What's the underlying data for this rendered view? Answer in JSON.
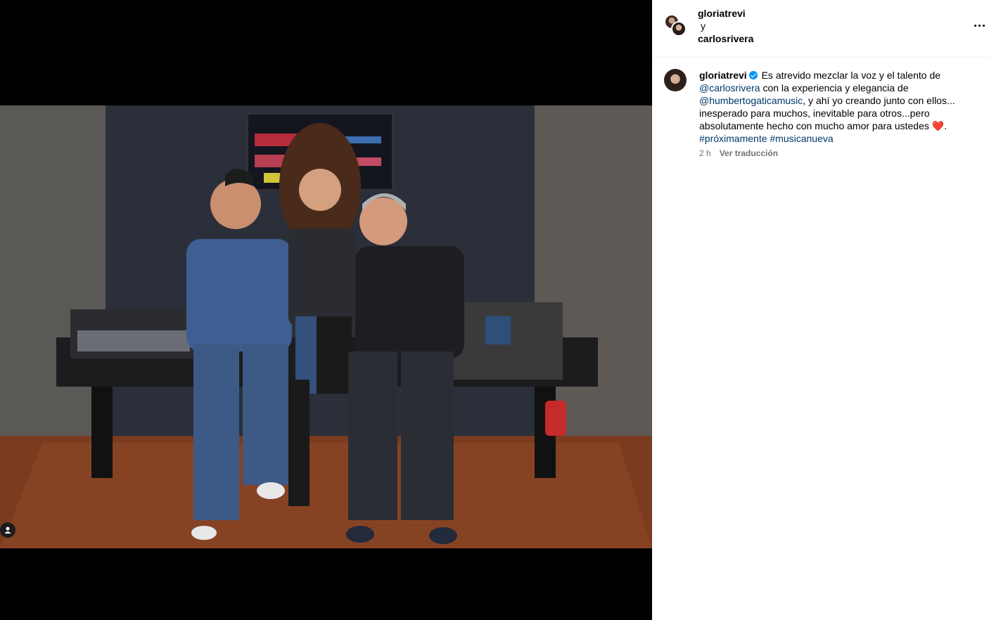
{
  "post": {
    "author1": "gloriatrevi",
    "connector": "y",
    "author2": "carlosrivera"
  },
  "caption": {
    "author": "gloriatrevi",
    "text1": "Es atrevido mezclar la voz y el talento de",
    "mention1": "@carlosrivera",
    "text2": "con la experiencia y elegancia de",
    "mention2": "@humbertogaticamusic",
    "text3": ", y ahí yo creando junto con ellos... inesperado para muchos, inevitable para otros...pero absolutamente hecho con mucho amor para ustedes",
    "heart": "❤️",
    "text4": ".",
    "hashtag1": "#próximamente",
    "hashtag2": "#musicanueva"
  },
  "meta": {
    "time": "2 h",
    "translate": "Ver traducción"
  },
  "icons": {
    "more": "more-options-icon",
    "verified": "verified-badge-icon",
    "tag": "user-tag-icon"
  },
  "colors": {
    "link": "#00376b",
    "verified": "#0095f6",
    "muted": "#737373"
  }
}
